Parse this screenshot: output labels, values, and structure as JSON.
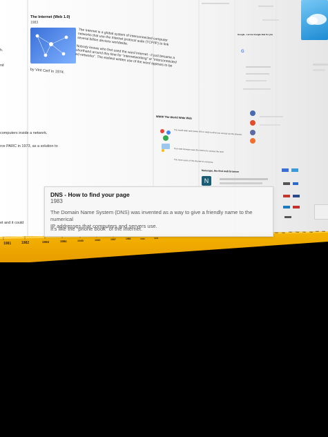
{
  "dns_card": {
    "title": "DNS - How to find your page",
    "year": "1983",
    "body_line1": "The Domain Name System (DNS) was invented as a way to give a friendly name to the numerical",
    "body_line2": "IP addresses that computers and servers use.",
    "body_line3": "It's like the “phone book” of the internet."
  },
  "internet_card": {
    "title": "The Internet (Web 1.0)",
    "year": "1983",
    "text_1": "The Internet is a global system of interconnected computer",
    "text_2": "networks that use the Internet protocol suite (TCP/IP) to link",
    "text_3": "several billion devices worldwide.",
    "text_4": "Nobody knows who first used the word Internet - it just became a",
    "text_5": "shorthand around this time for “internetworking” or “interconnected",
    "text_6": "ed networks”. The earliest written use of the word appears to be",
    "credit": "by Vint Cerf in 1974."
  },
  "left_fragments": {
    "f1": "computers inside a network.",
    "f2": "rox PARC in 1973, as a solution to",
    "f3": "et and it could",
    "f4": "h.",
    "f5": "nd"
  },
  "www_card": {
    "title": "WWW The World Wide Web",
    "l1": "The world wide web (www, W3 or web) is what you access via the internet.",
    "l2": "Your web browser uses the internet to access the web.",
    "l3": "The more users of the internet to everyone."
  },
  "netscape_card": {
    "title": "Netscape, the first web browser"
  },
  "google_card": {
    "title": "Google - Let me Google that for you"
  },
  "timeline": {
    "years": [
      "1981",
      "1982",
      "1983",
      "1984",
      "1985",
      "1986",
      "1987",
      "1988",
      "1989",
      "1990",
      "1991",
      "1992",
      "1993",
      "1994",
      "1995",
      "1996",
      "1997",
      "1998",
      "1999",
      "2000",
      "2001",
      "2002",
      "2003",
      "2004",
      "2005",
      "2006",
      "2007",
      "2008",
      "2009",
      "2010"
    ],
    "band_color": "#f2a900"
  }
}
